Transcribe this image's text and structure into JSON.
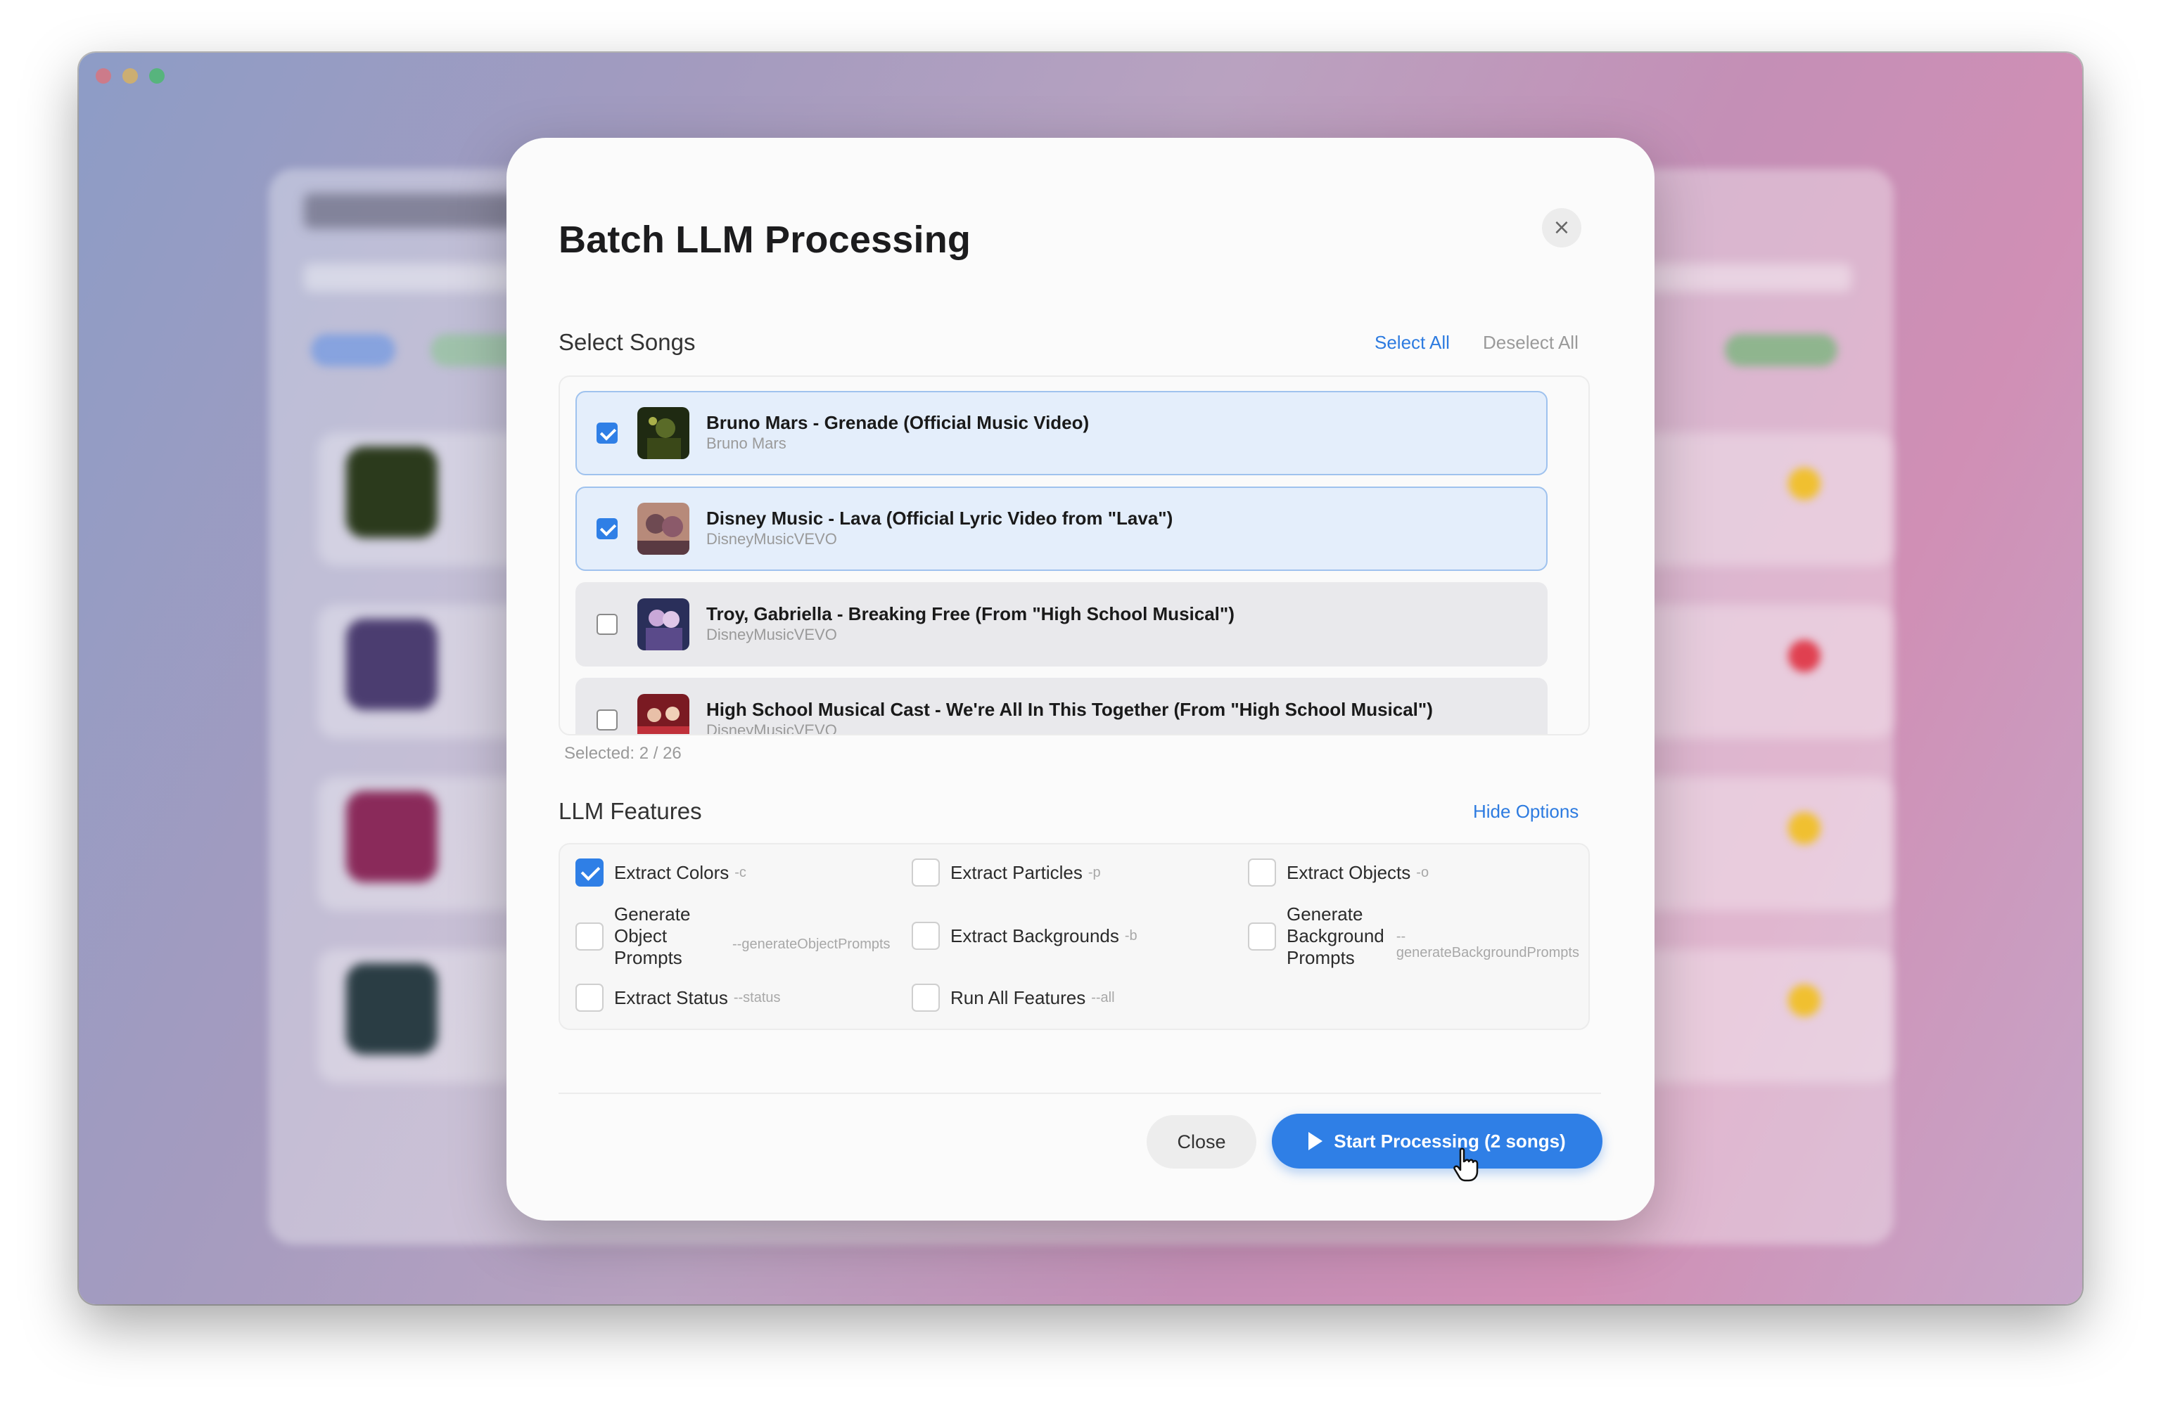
{
  "modal": {
    "title": "Batch LLM Processing",
    "close_icon": "×"
  },
  "songs_section": {
    "label": "Select Songs",
    "select_all": "Select All",
    "deselect_all": "Deselect All",
    "selected_count": "Selected: 2 / 26",
    "items": [
      {
        "title": "Bruno Mars - Grenade (Official Music Video)",
        "artist": "Bruno Mars",
        "checked": true
      },
      {
        "title": "Disney Music - Lava (Official Lyric Video from \"Lava\")",
        "artist": "DisneyMusicVEVO",
        "checked": true
      },
      {
        "title": "Troy, Gabriella - Breaking Free (From \"High School Musical\")",
        "artist": "DisneyMusicVEVO",
        "checked": false
      },
      {
        "title": "High School Musical Cast - We're All In This Together (From \"High School Musical\")",
        "artist": "DisneyMusicVEVO",
        "checked": false
      }
    ]
  },
  "features_section": {
    "label": "LLM Features",
    "hide_options": "Hide Options",
    "items": [
      {
        "label": "Extract Colors",
        "flag": "-c",
        "checked": true
      },
      {
        "label": "Extract Particles",
        "flag": "-p",
        "checked": false
      },
      {
        "label": "Extract Objects",
        "flag": "-o",
        "checked": false
      },
      {
        "label": "Generate Object Prompts",
        "flag": "--generateObjectPrompts",
        "checked": false
      },
      {
        "label": "Extract Backgrounds",
        "flag": "-b",
        "checked": false
      },
      {
        "label": "Generate Background Prompts",
        "flag": "--generateBackgroundPrompts",
        "checked": false
      },
      {
        "label": "Extract Status",
        "flag": "--status",
        "checked": false
      },
      {
        "label": "Run All Features",
        "flag": "--all",
        "checked": false
      }
    ]
  },
  "footer": {
    "close_label": "Close",
    "start_label": "Start Processing (2 songs)",
    "play_icon": "play-icon"
  },
  "colors": {
    "accent": "#2f7fe6",
    "selected_row_bg": "#e4eefb",
    "selected_row_border": "#9fc2ee"
  }
}
